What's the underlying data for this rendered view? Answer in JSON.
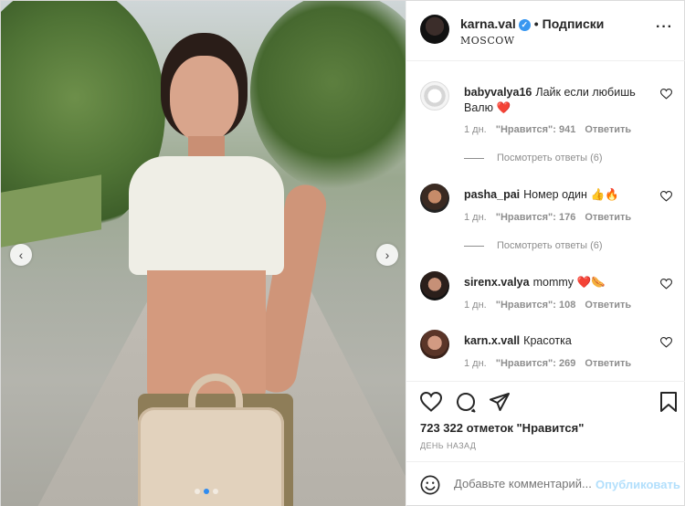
{
  "post": {
    "author": "karna.val",
    "separator": "•",
    "follow_label": "Подписки",
    "location": "MOSCOW",
    "more_label": "···"
  },
  "carousel": {
    "prev": "‹",
    "next": "›",
    "dots": 3,
    "active_dot": 1
  },
  "comments": [
    {
      "user": "babyvalya16",
      "text": "Лайк если любишь Валю",
      "emoji": "❤️",
      "age": "1 дн.",
      "likes": "\"Нравится\": 941",
      "reply": "Ответить",
      "replies": "Посмотреть ответы (6)"
    },
    {
      "user": "pasha_pai",
      "text": "Номер один",
      "emoji": "👍🔥",
      "age": "1 дн.",
      "likes": "\"Нравится\": 176",
      "reply": "Ответить",
      "replies": "Посмотреть ответы (6)"
    },
    {
      "user": "sirenx.valya",
      "text": "mommy",
      "emoji": "❤️🌭",
      "age": "1 дн.",
      "likes": "\"Нравится\": 108",
      "reply": "Ответить"
    },
    {
      "user": "karn.x.vall",
      "text": "Красотка",
      "emoji": "",
      "age": "1 дн.",
      "likes": "\"Нравится\": 269",
      "reply": "Ответить"
    }
  ],
  "stats": {
    "likes": "723 322 отметок \"Нравится\"",
    "date": "ДЕНЬ НАЗАД"
  },
  "composer": {
    "placeholder": "Добавьте комментарий...",
    "publish": "Опубликовать"
  },
  "colors": {
    "verified": "#3897f0",
    "heart": "#ed4956",
    "publish_disabled": "#b2dffc",
    "muted": "#8e8e8e"
  }
}
